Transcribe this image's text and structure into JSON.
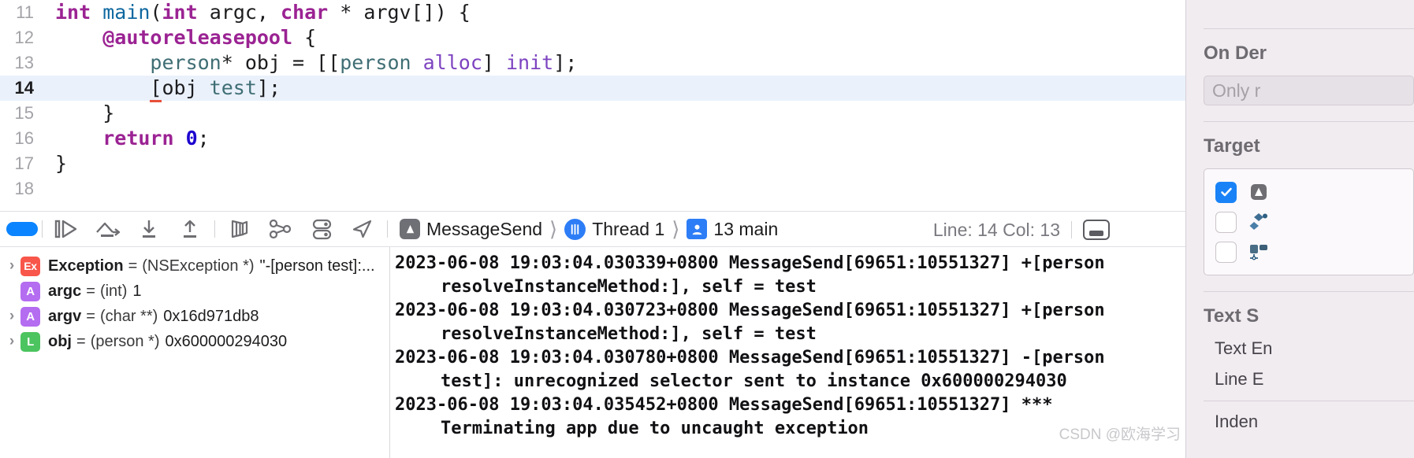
{
  "editor": {
    "lines": [
      {
        "num": "11",
        "current": false,
        "tokens": [
          {
            "t": "int ",
            "c": "kw"
          },
          {
            "t": "main",
            "c": "type"
          },
          {
            "t": "(",
            "c": "plain"
          },
          {
            "t": "int ",
            "c": "kw"
          },
          {
            "t": "argc, ",
            "c": "plain"
          },
          {
            "t": "char ",
            "c": "kw"
          },
          {
            "t": "* argv[]) {",
            "c": "plain"
          }
        ]
      },
      {
        "num": "12",
        "current": false,
        "tokens": [
          {
            "t": "    ",
            "c": "plain"
          },
          {
            "t": "@autoreleasepool",
            "c": "kw"
          },
          {
            "t": " {",
            "c": "plain"
          }
        ]
      },
      {
        "num": "13",
        "current": false,
        "tokens": [
          {
            "t": "        ",
            "c": "plain"
          },
          {
            "t": "person",
            "c": "cls"
          },
          {
            "t": "* obj = [[",
            "c": "plain"
          },
          {
            "t": "person",
            "c": "cls"
          },
          {
            "t": " ",
            "c": "plain"
          },
          {
            "t": "alloc",
            "c": "msg"
          },
          {
            "t": "] ",
            "c": "plain"
          },
          {
            "t": "init",
            "c": "msg"
          },
          {
            "t": "];",
            "c": "plain"
          }
        ]
      },
      {
        "num": "14",
        "current": true,
        "tokens": [
          {
            "t": "        ",
            "c": "plain"
          },
          {
            "t": "[",
            "c": "plain err"
          },
          {
            "t": "obj ",
            "c": "plain"
          },
          {
            "t": "test",
            "c": "cls"
          },
          {
            "t": "];",
            "c": "plain"
          }
        ]
      },
      {
        "num": "15",
        "current": false,
        "tokens": [
          {
            "t": "    }",
            "c": "plain"
          }
        ]
      },
      {
        "num": "16",
        "current": false,
        "tokens": [
          {
            "t": "    ",
            "c": "plain"
          },
          {
            "t": "return ",
            "c": "kw"
          },
          {
            "t": "0",
            "c": "num"
          },
          {
            "t": ";",
            "c": "plain"
          }
        ]
      },
      {
        "num": "17",
        "current": false,
        "tokens": [
          {
            "t": "}",
            "c": "plain"
          }
        ]
      },
      {
        "num": "18",
        "current": false,
        "tokens": [
          {
            "t": "",
            "c": "plain"
          }
        ]
      }
    ]
  },
  "debug_bar": {
    "icons": [
      {
        "name": "continue-execution",
        "label": "Continue"
      },
      {
        "name": "step-over",
        "label": "Step Over"
      },
      {
        "name": "step-into",
        "label": "Step Into"
      },
      {
        "name": "step-out",
        "label": "Step Out"
      },
      {
        "name": "debug-view-hierarchy",
        "label": "Debug View Hierarchy"
      },
      {
        "name": "debug-memory-graph",
        "label": "Debug Memory Graph"
      },
      {
        "name": "environment-overrides",
        "label": "Environment Overrides"
      },
      {
        "name": "simulate-location",
        "label": "Simulate Location"
      }
    ],
    "breadcrumb": [
      {
        "label": "MessageSend",
        "icon": "app-icon"
      },
      {
        "label": "Thread 1",
        "icon": "thread-icon"
      },
      {
        "label": "13 main",
        "icon": "frame-icon"
      }
    ],
    "line_col": "Line: 14  Col: 13"
  },
  "variables": {
    "rows": [
      {
        "disclosure": true,
        "badge": "Ex",
        "badge_kind": "ex",
        "name": "Exception",
        "type": "(NSException *)",
        "value": "\"-[person test]:..."
      },
      {
        "disclosure": false,
        "badge": "A",
        "badge_kind": "a",
        "name": "argc",
        "type": "(int)",
        "value": "1"
      },
      {
        "disclosure": true,
        "badge": "A",
        "badge_kind": "a",
        "name": "argv",
        "type": "(char **)",
        "value": "0x16d971db8"
      },
      {
        "disclosure": true,
        "badge": "L",
        "badge_kind": "l",
        "name": "obj",
        "type": "(person *)",
        "value": "0x600000294030"
      }
    ]
  },
  "console": {
    "lines": [
      {
        "text": "2023-06-08 19:03:04.030339+0800 MessageSend[69651:10551327] +[person",
        "cont": false
      },
      {
        "text": "resolveInstanceMethod:], self = test",
        "cont": true
      },
      {
        "text": "2023-06-08 19:03:04.030723+0800 MessageSend[69651:10551327] +[person",
        "cont": false
      },
      {
        "text": "resolveInstanceMethod:], self = test",
        "cont": true
      },
      {
        "text": "2023-06-08 19:03:04.030780+0800 MessageSend[69651:10551327] -[person",
        "cont": false
      },
      {
        "text": "test]: unrecognized selector sent to instance 0x600000294030",
        "cont": true
      },
      {
        "text": "2023-06-08 19:03:04.035452+0800 MessageSend[69651:10551327] ***",
        "cont": false
      },
      {
        "text": "Terminating app due to uncaught exception",
        "cont": true
      }
    ]
  },
  "inspector": {
    "on_demand_title": "On Der",
    "on_demand_field": "Only r",
    "target_title": "Target",
    "targets": [
      {
        "checked": true,
        "icon": "app-target-icon"
      },
      {
        "checked": false,
        "icon": "framework-target-icon"
      },
      {
        "checked": false,
        "icon": "tests-target-icon"
      }
    ],
    "text_settings_title": "Text S",
    "text_settings_rows": [
      {
        "label": "Text En"
      },
      {
        "label": "Line E"
      },
      {
        "label": "Inden"
      }
    ]
  },
  "watermark": "CSDN @欧海学习"
}
